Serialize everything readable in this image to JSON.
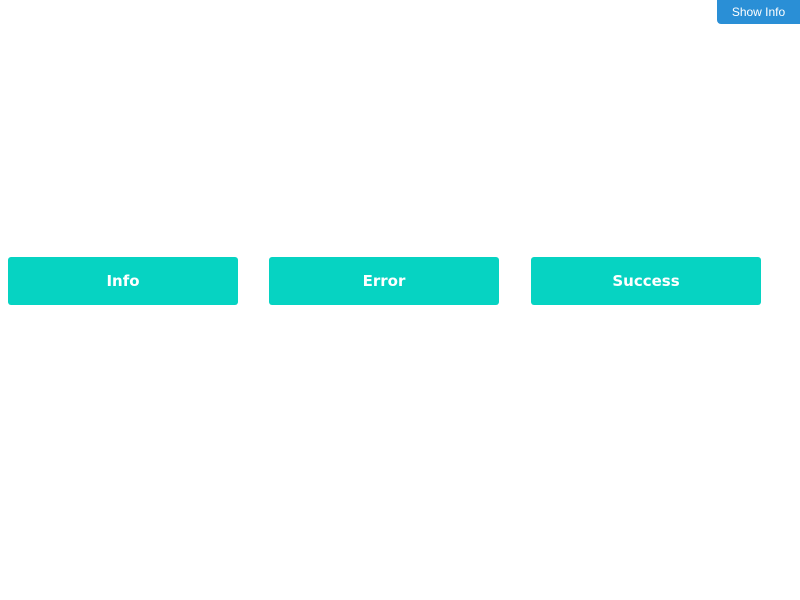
{
  "header": {
    "show_info_label": "Show Info"
  },
  "buttons": [
    {
      "label": "Info"
    },
    {
      "label": "Error"
    },
    {
      "label": "Success"
    }
  ],
  "colors": {
    "show_info_bg": "#2a8fd6",
    "button_bg": "#06d3c2",
    "button_text": "#ffffff",
    "page_bg": "#ffffff"
  }
}
